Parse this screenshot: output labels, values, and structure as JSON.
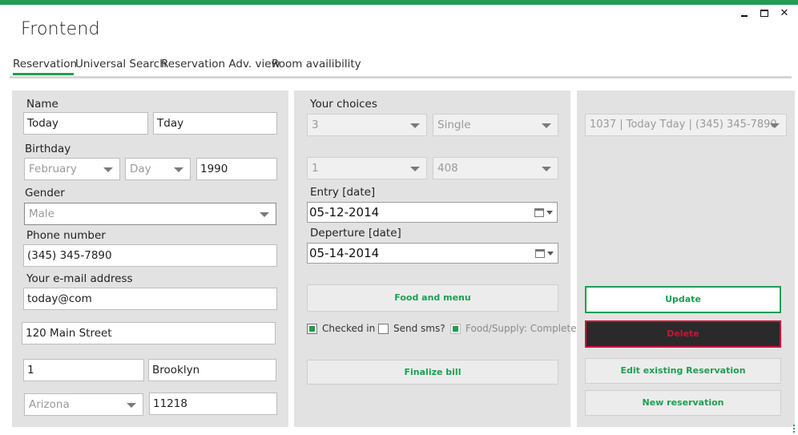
{
  "window": {
    "title": "Frontend",
    "controls": {
      "minimize": "minimize",
      "maximize": "maximize",
      "close": "✕"
    },
    "accent_color": "#1e9e52"
  },
  "tabs": [
    {
      "label": "Reservation",
      "active": true
    },
    {
      "label": "Universal Search",
      "active": false
    },
    {
      "label": "Reservation Adv. view",
      "active": false
    },
    {
      "label": "Room availibility",
      "active": false
    }
  ],
  "guest": {
    "name_label": "Name",
    "first_name": "Today",
    "last_name": "Tday",
    "birthday_label": "Birthday",
    "birth_month": "February",
    "birth_day": "Day",
    "birth_year": "1990",
    "gender_label": "Gender",
    "gender": "Male",
    "phone_label": "Phone number",
    "phone": "(345) 345-7890",
    "email_label": "Your e-mail address",
    "email": "today@com",
    "street": "120 Main Street",
    "house_number": "1",
    "city": "Brooklyn",
    "state": "Arizona",
    "zip": "11218"
  },
  "choices": {
    "label": "Your choices",
    "guests": "3",
    "room_type": "Single",
    "nights": "1",
    "room_number": "408",
    "entry_label": "Entry [date]",
    "entry_date": "05-12-2014",
    "departure_label": "Deperture [date]",
    "departure_date": "05-14-2014",
    "food_button": "Food and menu",
    "checked_in_label": "Checked in",
    "checked_in": true,
    "send_sms_label": "Send sms?",
    "send_sms": false,
    "food_supply_label": "Food/Supply: Complete",
    "food_supply": true,
    "finalize_button": "Finalize bill"
  },
  "actions": {
    "reservation_select": "1037  | Today  Tday | (345) 345-7890",
    "update_button": "Update",
    "delete_button": "Delete",
    "edit_button": "Edit existing Reservation",
    "new_button": "New reservation",
    "danger_color": "#d0103a"
  }
}
